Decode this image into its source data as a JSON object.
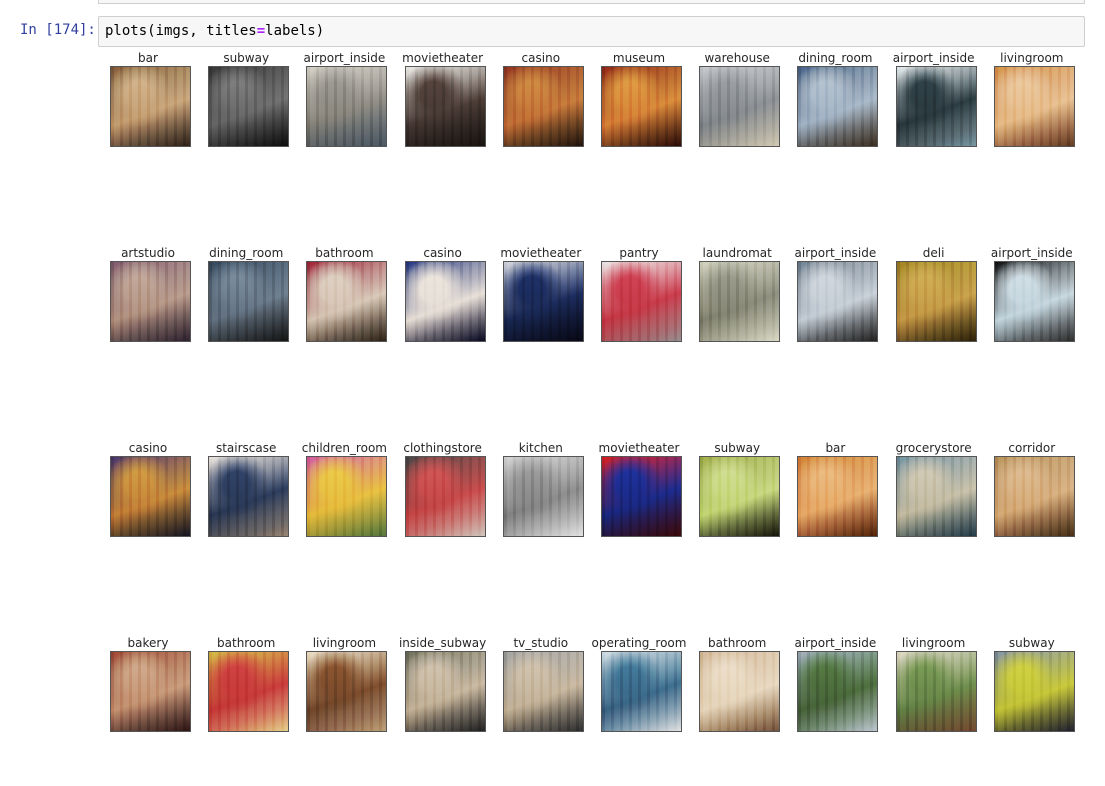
{
  "cell": {
    "prompt": "In [174]:",
    "code_func": "plots(imgs, titles",
    "code_op": "=",
    "code_arg": "labels)"
  },
  "grid": {
    "rows": [
      [
        {
          "label": "bar",
          "colors": [
            "#6b4a2e",
            "#c9a57a",
            "#3b2a1f"
          ]
        },
        {
          "label": "subway",
          "colors": [
            "#2b2b2b",
            "#6d6d6d",
            "#111111"
          ]
        },
        {
          "label": "airport_inside",
          "colors": [
            "#c8c3b8",
            "#8d8a82",
            "#5a6b7a"
          ]
        },
        {
          "label": "movietheater",
          "colors": [
            "#e9e6e0",
            "#4a3b35",
            "#1e1814"
          ]
        },
        {
          "label": "casino",
          "colors": [
            "#7a2a1a",
            "#c77a3a",
            "#2a1a12"
          ]
        },
        {
          "label": "museum",
          "colors": [
            "#7a1f12",
            "#d98a3a",
            "#3a0f0a"
          ]
        },
        {
          "label": "warehouse",
          "colors": [
            "#b8bcc0",
            "#8a8e92",
            "#d9d2c0"
          ]
        },
        {
          "label": "dining_room",
          "colors": [
            "#3a5070",
            "#a8b8c8",
            "#4a3a2a"
          ]
        },
        {
          "label": "airport_inside",
          "colors": [
            "#dfe7ea",
            "#2a3a40",
            "#90a8b0"
          ]
        },
        {
          "label": "livingroom",
          "colors": [
            "#c97a3a",
            "#e8c090",
            "#7a4a2a"
          ]
        }
      ],
      [
        {
          "label": "artstudio",
          "colors": [
            "#6a4a5a",
            "#b89a8a",
            "#3a2a3a"
          ]
        },
        {
          "label": "dining_room",
          "colors": [
            "#2a3a4a",
            "#6a7a8a",
            "#1a1a1a"
          ]
        },
        {
          "label": "bathroom",
          "colors": [
            "#8a1a2a",
            "#d8c8b8",
            "#3a2a1a"
          ]
        },
        {
          "label": "casino",
          "colors": [
            "#1a2a6a",
            "#e8e0d8",
            "#0a0a2a"
          ]
        },
        {
          "label": "movietheater",
          "colors": [
            "#c8ccd8",
            "#1a2a5a",
            "#0a0a1a"
          ]
        },
        {
          "label": "pantry",
          "colors": [
            "#e8e0e0",
            "#c83a4a",
            "#a8a0a0"
          ]
        },
        {
          "label": "laundromat",
          "colors": [
            "#c8c8b0",
            "#8a8a7a",
            "#e0e0d0"
          ]
        },
        {
          "label": "airport_inside",
          "colors": [
            "#5a6a7a",
            "#c8d0d8",
            "#2a2a2a"
          ]
        },
        {
          "label": "deli",
          "colors": [
            "#8a6a1a",
            "#c8a04a",
            "#3a2a0a"
          ]
        },
        {
          "label": "airport_inside",
          "colors": [
            "#0a0a0a",
            "#c8d8e0",
            "#3a3a3a"
          ]
        }
      ],
      [
        {
          "label": "casino",
          "colors": [
            "#3a2a5a",
            "#c88a3a",
            "#1a1a2a"
          ]
        },
        {
          "label": "stairscase",
          "colors": [
            "#e8e0d8",
            "#2a3a5a",
            "#a89888"
          ]
        },
        {
          "label": "children_room",
          "colors": [
            "#c84a8a",
            "#e8c040",
            "#6a8a4a"
          ]
        },
        {
          "label": "clothingstore",
          "colors": [
            "#3a3a3a",
            "#c84a4a",
            "#d8d0c8"
          ]
        },
        {
          "label": "kitchen",
          "colors": [
            "#c8c8c8",
            "#8a8a8a",
            "#e8e8e8"
          ]
        },
        {
          "label": "movietheater",
          "colors": [
            "#c81a1a",
            "#1a2a8a",
            "#4a0a0a"
          ]
        },
        {
          "label": "subway",
          "colors": [
            "#8a9a3a",
            "#c8d880",
            "#1a1a0a"
          ]
        },
        {
          "label": "bar",
          "colors": [
            "#c86a2a",
            "#e8b070",
            "#6a2a0a"
          ]
        },
        {
          "label": "grocerystore",
          "colors": [
            "#5a7a8a",
            "#c8c0a8",
            "#2a4a5a"
          ]
        },
        {
          "label": "corridor",
          "colors": [
            "#a87a4a",
            "#d8b080",
            "#5a3a1a"
          ]
        }
      ],
      [
        {
          "label": "bakery",
          "colors": [
            "#8a3a2a",
            "#c89a7a",
            "#3a1a1a"
          ]
        },
        {
          "label": "bathroom",
          "colors": [
            "#c8a83a",
            "#c83a3a",
            "#e8d8a0"
          ]
        },
        {
          "label": "livingroom",
          "colors": [
            "#e8d8b8",
            "#7a4a2a",
            "#c8b090"
          ]
        },
        {
          "label": "inside_subway",
          "colors": [
            "#5a5a4a",
            "#c8b8a0",
            "#2a2a2a"
          ]
        },
        {
          "label": "tv_studio",
          "colors": [
            "#8a8a8a",
            "#c8b8a0",
            "#3a3a3a"
          ]
        },
        {
          "label": "operating_room",
          "colors": [
            "#c8d8e0",
            "#3a6a8a",
            "#e8e8e8"
          ]
        },
        {
          "label": "bathroom",
          "colors": [
            "#c8a880",
            "#e8d8c0",
            "#8a6a4a"
          ]
        },
        {
          "label": "airport_inside",
          "colors": [
            "#8a9aa8",
            "#4a6a3a",
            "#c8d0d8"
          ]
        },
        {
          "label": "livingroom",
          "colors": [
            "#d8d0b8",
            "#6a8a4a",
            "#8a5a3a"
          ]
        },
        {
          "label": "subway",
          "colors": [
            "#6a7a8a",
            "#c8c83a",
            "#2a2a3a"
          ]
        }
      ]
    ]
  }
}
